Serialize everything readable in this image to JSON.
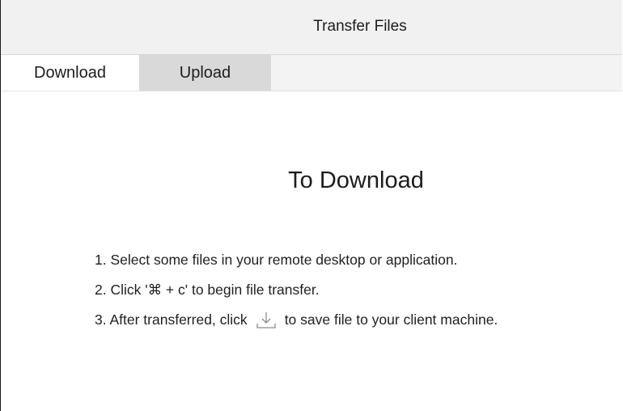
{
  "window": {
    "title": "Transfer Files"
  },
  "tabs": [
    {
      "label": "Download",
      "active": true
    },
    {
      "label": "Upload",
      "active": false
    }
  ],
  "main": {
    "heading": "To Download",
    "steps": [
      {
        "text": "1. Select some files in your remote desktop or application."
      },
      {
        "text": "2. Click '⌘ + c' to begin file transfer."
      },
      {
        "text_before_icon": "3. After transferred, click",
        "icon": "download-icon",
        "text_after_icon": "to save file to your client machine."
      }
    ]
  },
  "colors": {
    "titlebar_bg": "#f1f1f1",
    "active_tab_bg": "#ffffff",
    "inactive_tab_bg": "#d9d9d9",
    "icon_stroke": "#8a8a8a"
  }
}
